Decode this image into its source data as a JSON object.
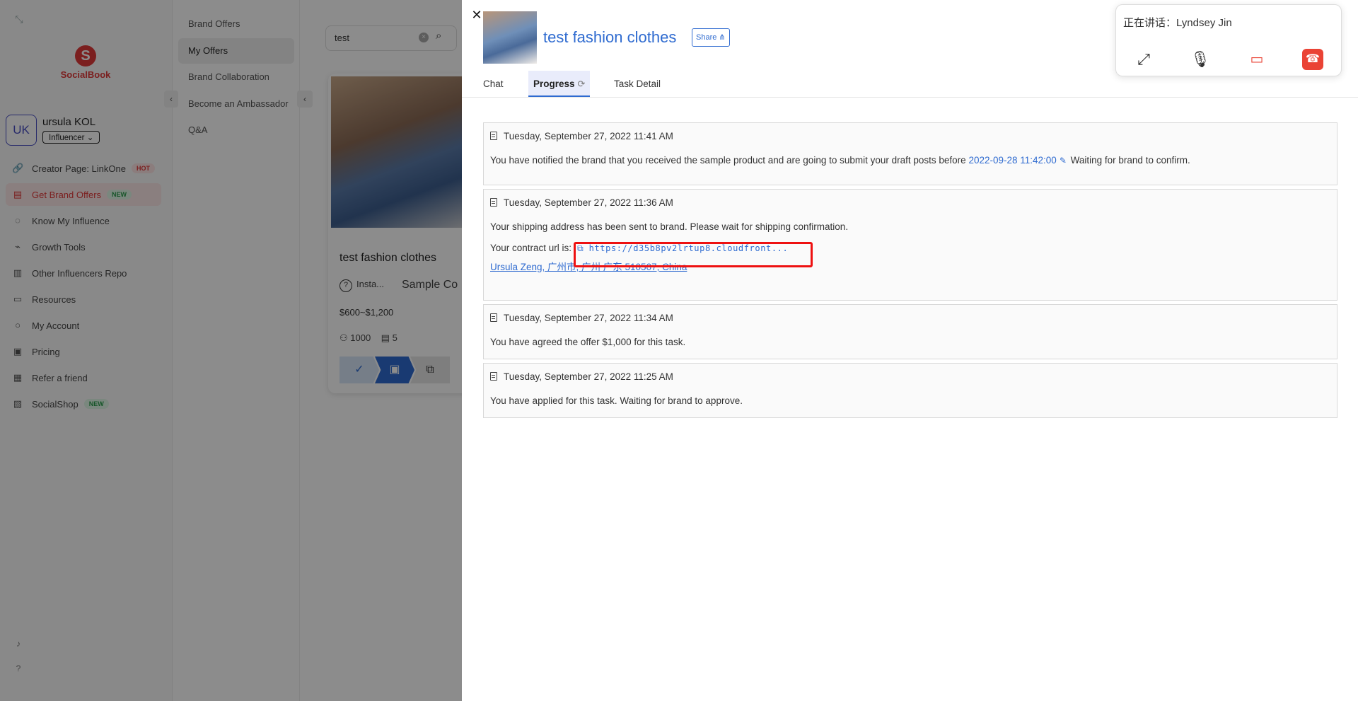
{
  "app": {
    "brand_name": "SocialBook",
    "user": {
      "initials": "UK",
      "name": "ursula KOL",
      "role": "Influencer"
    },
    "nav": [
      {
        "label": "Creator Page: LinkOne",
        "icon": "link-icon",
        "badge": "HOT"
      },
      {
        "label": "Get Brand Offers",
        "icon": "offer-icon",
        "badge": "NEW",
        "active": true
      },
      {
        "label": "Know My Influence",
        "icon": "chat-icon"
      },
      {
        "label": "Growth Tools",
        "icon": "chart-icon"
      },
      {
        "label": "Other Influencers Reports",
        "icon": "report-icon"
      },
      {
        "label": "Resources",
        "icon": "folder-icon"
      },
      {
        "label": "My Account",
        "icon": "user-icon"
      },
      {
        "label": "Pricing",
        "icon": "pricing-icon"
      },
      {
        "label": "Refer a friend",
        "icon": "gift-icon"
      },
      {
        "label": "SocialShop",
        "icon": "shop-icon",
        "badge": "NEW"
      }
    ],
    "subnav": [
      {
        "label": "Brand Offers"
      },
      {
        "label": "My Offers",
        "active": true
      },
      {
        "label": "Brand Collaboration"
      },
      {
        "label": "Become an Ambassador"
      },
      {
        "label": "Q&A"
      }
    ],
    "search": {
      "value": "test"
    },
    "offer_card": {
      "title": "test fashion clothes",
      "platform": "Insta...",
      "type": "Sample Co",
      "price": "$600~$1,200",
      "followers": "1000",
      "posts": "5"
    }
  },
  "drawer": {
    "title": "test fashion clothes",
    "share_label": "Share",
    "tabs": [
      {
        "label": "Chat"
      },
      {
        "label": "Progress",
        "active": true
      },
      {
        "label": "Task Detail"
      }
    ],
    "timeline": [
      {
        "timestamp": "Tuesday, September 27, 2022 11:41 AM",
        "text_before": "You have notified the brand that you received the sample product and are going to submit your draft posts before",
        "date_link": "2022-09-28 11:42:00",
        "text_after": "Waiting for brand to confirm."
      },
      {
        "timestamp": "Tuesday, September 27, 2022 11:36 AM",
        "text": "Your shipping address has been sent to brand. Please wait for shipping confirmation.",
        "contract_label": "Your contract url is:",
        "contract_url": "https://d35b8pv2lrtup8.cloudfront...",
        "address": "Ursula Zeng, 广州市, 广州 广东 510507, China"
      },
      {
        "timestamp": "Tuesday, September 27, 2022 11:34 AM",
        "text": "You have agreed the offer $1,000 for this task."
      },
      {
        "timestamp": "Tuesday, September 27, 2022 11:25 AM",
        "text": "You have applied for this task. Waiting for brand to approve."
      }
    ]
  },
  "call": {
    "title": "正在讲话：Lyndsey Jin"
  },
  "colors": {
    "brand_red": "#e03a3a",
    "link_blue": "#2f6bd0",
    "highlight_red": "#ee1111",
    "hangup_red": "#ea4335"
  }
}
